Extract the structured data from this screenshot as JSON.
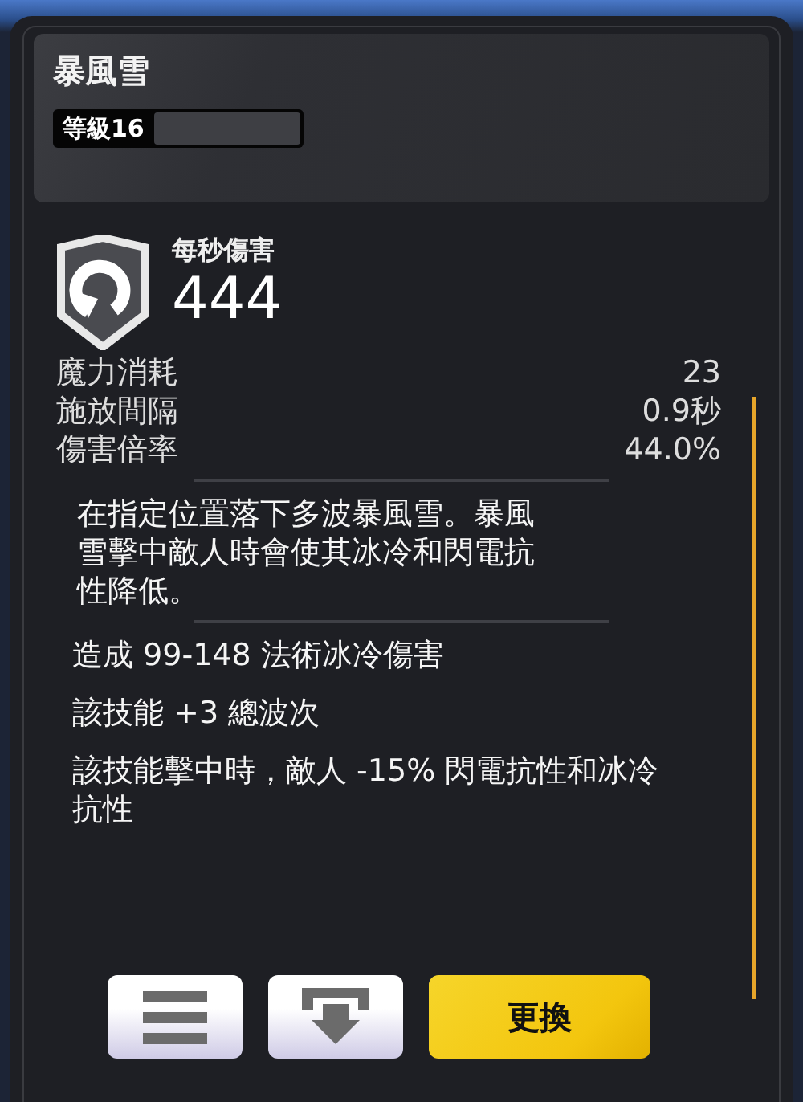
{
  "skill": {
    "name": "暴風雪",
    "level_label": "等級16",
    "level": 0
  },
  "dps": {
    "label": "每秒傷害",
    "value": "444"
  },
  "stats": [
    {
      "label": "魔力消耗",
      "value": "23"
    },
    {
      "label": "施放間隔",
      "value": "0.9秒"
    },
    {
      "label": "傷害倍率",
      "value": "44.0%"
    }
  ],
  "description": "在指定位置落下多波暴風雪。暴風雪擊中敵人時會使其冰冷和閃電抗性降低。",
  "modifiers": [
    "造成 99-148 法術冰冷傷害",
    "該技能 +3 總波次",
    "該技能擊中時，敵人 -15% 閃電抗性和冰冷抗性"
  ],
  "buttons": [
    {
      "kind": "list"
    },
    {
      "kind": "unequip"
    },
    {
      "kind": "text",
      "label": "更換"
    }
  ]
}
